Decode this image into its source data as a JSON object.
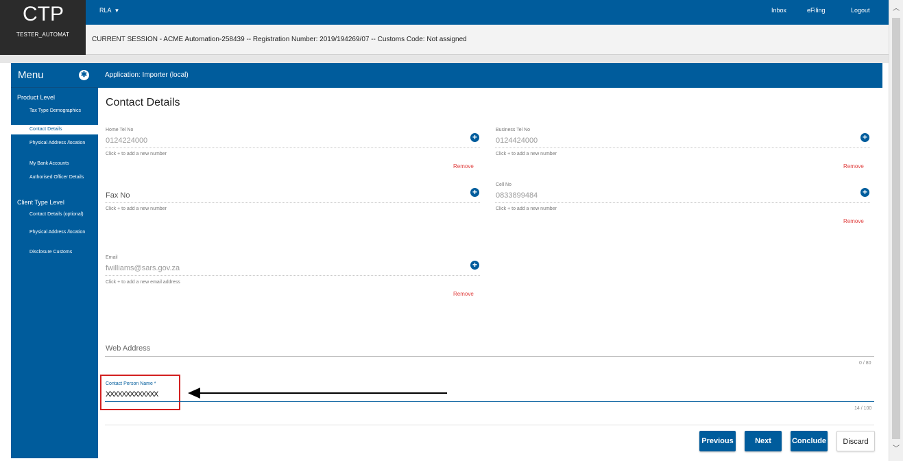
{
  "app": {
    "logo": "CTP",
    "user": "TESTER_AUTOMAT"
  },
  "topbar": {
    "role": "RLA",
    "nav": [
      "Inbox",
      "eFiling",
      "Logout"
    ]
  },
  "session": {
    "text": "CURRENT SESSION - ACME Automation-258439 -- Registration Number: 2019/194269/07 -- Customs Code: Not assigned"
  },
  "sidebar": {
    "title": "Menu",
    "sections": [
      {
        "label": "Product Level",
        "items": [
          {
            "label": "Tax Type Demographics"
          },
          {
            "label": "Contact Details"
          },
          {
            "label": "Physical Address /location"
          },
          {
            "label": "My Bank Accounts"
          },
          {
            "label": "Authorised Officer Details"
          }
        ]
      },
      {
        "label": "Client Type Level",
        "items": [
          {
            "label": "Contact Details (optional)"
          },
          {
            "label": "Physical Address /location"
          },
          {
            "label": "Disclosure Customs"
          }
        ]
      }
    ]
  },
  "main": {
    "app_label": "Application: Importer (local)",
    "title": "Contact Details",
    "home_tel": {
      "label": "Home Tel No",
      "value": "0124224000",
      "hint": "Click + to add a new number",
      "remove": "Remove"
    },
    "business_tel": {
      "label": "Business Tel No",
      "value": "0124424000",
      "hint": "Click + to add a new number",
      "remove": "Remove"
    },
    "fax": {
      "label": "Fax No",
      "hint": "Click + to add a new number"
    },
    "cell": {
      "label": "Cell No",
      "value": "0833899484",
      "hint": "Click + to add a new number",
      "remove": "Remove"
    },
    "email": {
      "label": "Email",
      "value": "fwilliams@sars.gov.za",
      "hint": "Click + to add a new email address",
      "remove": "Remove"
    },
    "web": {
      "label": "Web Address",
      "counter": "0 / 80"
    },
    "contact_person": {
      "label": "Contact Person Name *",
      "value": "XXXXXXXXXXXXX",
      "counter": "14 / 100"
    }
  },
  "buttons": {
    "previous": "Previous",
    "next": "Next",
    "conclude": "Conclude",
    "discard": "Discard"
  }
}
